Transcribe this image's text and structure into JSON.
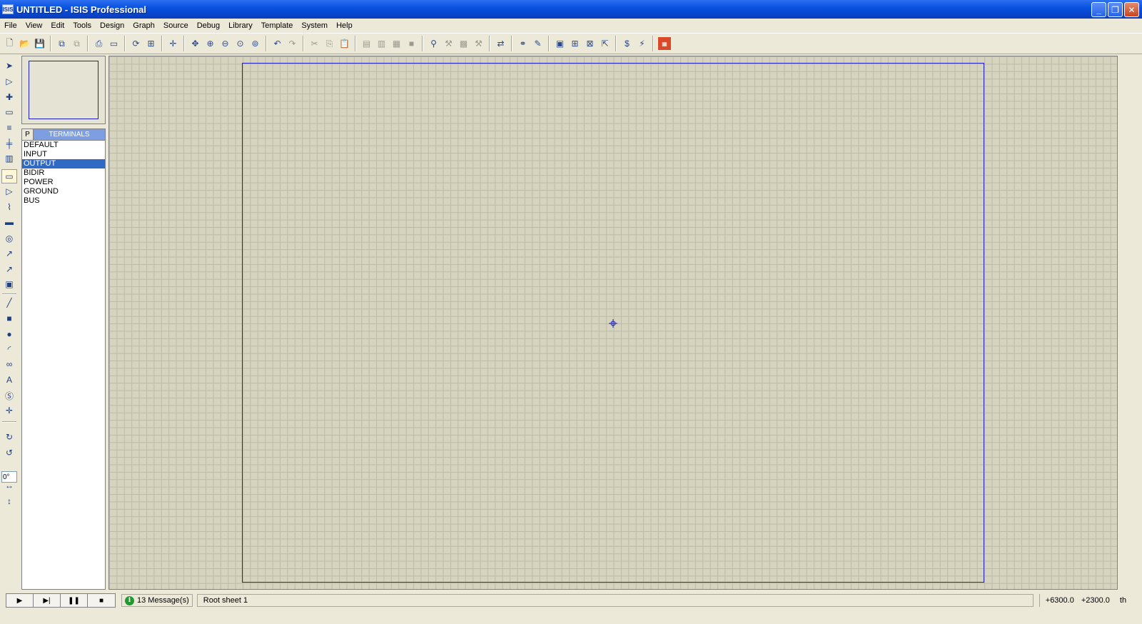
{
  "window": {
    "app_icon": "ISIS",
    "title": "UNTITLED - ISIS Professional",
    "controls": {
      "minimize": "_",
      "maximize": "❐",
      "close": "✕"
    }
  },
  "menu": [
    "File",
    "View",
    "Edit",
    "Tools",
    "Design",
    "Graph",
    "Source",
    "Debug",
    "Library",
    "Template",
    "System",
    "Help"
  ],
  "device_panel": {
    "pick_label": "P",
    "title": "TERMINALS",
    "items": [
      "DEFAULT",
      "INPUT",
      "OUTPUT",
      "BIDIR",
      "POWER",
      "GROUND",
      "BUS"
    ],
    "selected": "OUTPUT"
  },
  "rotation": {
    "angle": "0°"
  },
  "status": {
    "messages": "13 Message(s)",
    "sheet": "Root sheet 1",
    "coord_x": "+6300.0",
    "coord_y": "+2300.0",
    "units": "th"
  },
  "anim": {
    "play": "▶",
    "step": "▶|",
    "pause": "❚❚",
    "stop": "■"
  },
  "toolbar_icons": [
    "new-icon",
    "open-icon",
    "save-icon",
    "import-icon",
    "export-icon",
    "print-icon",
    "area-icon",
    "refresh-icon",
    "grid-icon",
    "origin-icon",
    "pan-icon",
    "zoom-in-icon",
    "zoom-out-icon",
    "zoom-all-icon",
    "zoom-area-icon",
    "undo-icon",
    "redo-icon",
    "cut-icon",
    "copy-icon",
    "paste-icon",
    "block-copy-icon",
    "block-move-icon",
    "block-rotate-icon",
    "block-delete-icon",
    "pick-device-icon",
    "make-device-icon",
    "packaging-icon",
    "decompose-icon",
    "wire-autorouter-icon",
    "search-icon",
    "property-assign-icon",
    "new-sheet-icon",
    "add-sheet-icon",
    "remove-sheet-icon",
    "goto-sheet-icon",
    "bom-icon",
    "erc-icon",
    "ares-icon"
  ],
  "colors": {
    "titlebar": "#0a53e0",
    "canvas": "#d6d3bf",
    "sheet_border": "#2020c0",
    "selected": "#316ac5"
  }
}
